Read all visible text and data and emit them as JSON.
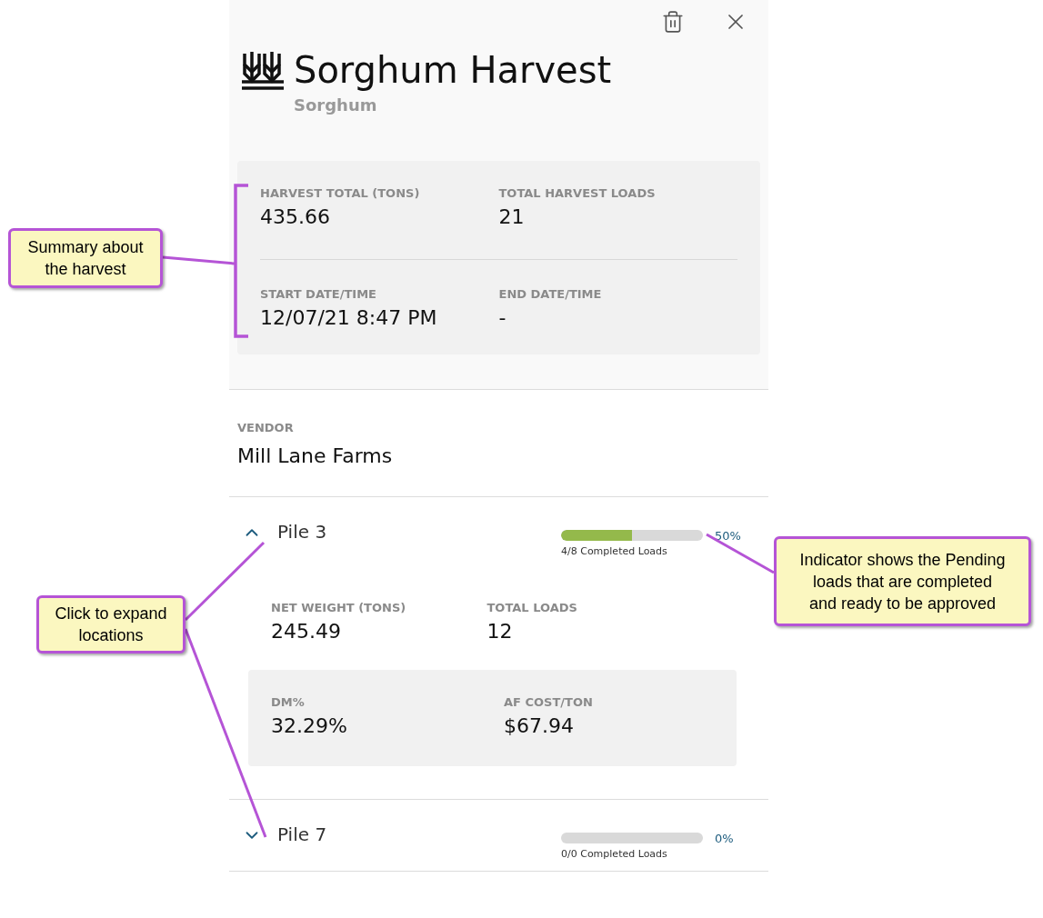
{
  "header": {
    "title": "Sorghum Harvest",
    "subtitle": "Sorghum"
  },
  "summary": {
    "rows": [
      [
        {
          "label": "HARVEST TOTAL (TONS)",
          "value": "435.66"
        },
        {
          "label": "TOTAL HARVEST LOADS",
          "value": "21"
        }
      ],
      [
        {
          "label": "START DATE/TIME",
          "value": "12/07/21 8:47 PM"
        },
        {
          "label": "END DATE/TIME",
          "value": "-"
        }
      ]
    ]
  },
  "vendor": {
    "label": "VENDOR",
    "value": "Mill Lane Farms"
  },
  "piles": [
    {
      "name": "Pile 3",
      "expanded": true,
      "level": 0.5,
      "percent": "50%",
      "caption": "4/8 Completed Loads",
      "stats": [
        {
          "label": "NET WEIGHT (TONS)",
          "value": "245.49"
        },
        {
          "label": "TOTAL LOADS",
          "value": "12"
        }
      ],
      "card": [
        {
          "label": "DM%",
          "value": "32.29%"
        },
        {
          "label": "AF COST/TON",
          "value": "$67.94"
        }
      ]
    },
    {
      "name": "Pile 7",
      "expanded": false,
      "level": 0,
      "percent": "0%",
      "caption": "0/0 Completed Loads"
    }
  ],
  "callouts": [
    {
      "text": "Summary about\nthe harvest"
    },
    {
      "text": "Click to expand\nlocations"
    },
    {
      "text": "Indicator shows the Pending\nloads that are completed\nand ready to be approved"
    }
  ]
}
